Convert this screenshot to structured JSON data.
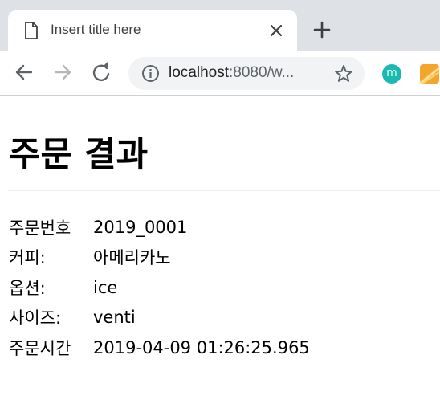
{
  "browser": {
    "tab": {
      "title": "Insert title here",
      "icon": "document-icon",
      "close_icon": "close-icon"
    },
    "new_tab_icon": "plus-icon",
    "nav": {
      "back_icon": "arrow-left-icon",
      "forward_icon": "arrow-right-icon",
      "reload_icon": "reload-icon"
    },
    "address": {
      "host": "localhost",
      "rest": ":8080/w..."
    },
    "bookmark_icon": "star-icon",
    "extensions": [
      {
        "name": "m-extension-icon",
        "letter": "m",
        "color": "#1cb9b0"
      },
      {
        "name": "orange-extension-icon",
        "color": "#f4a52b"
      }
    ]
  },
  "page": {
    "heading": "주문 결과",
    "rows": [
      {
        "label": "주문번호",
        "value": "2019_0001"
      },
      {
        "label": "커피:",
        "value": "아메리카노"
      },
      {
        "label": "옵션:",
        "value": "ice"
      },
      {
        "label": "사이즈:",
        "value": "venti"
      },
      {
        "label": "주문시간",
        "value": "2019-04-09 01:26:25.965"
      }
    ]
  }
}
